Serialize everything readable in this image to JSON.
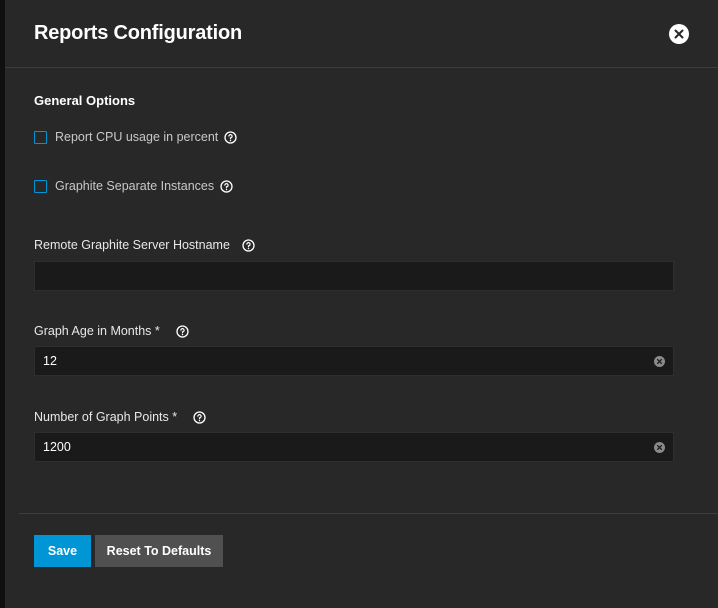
{
  "dialog": {
    "title": "Reports Configuration",
    "close_icon": "close-circle-icon"
  },
  "general_options": {
    "title": "General Options",
    "checkboxes": [
      {
        "label": "Report CPU usage in percent",
        "checked": false
      },
      {
        "label": "Graphite Separate Instances",
        "checked": false
      }
    ]
  },
  "fields": {
    "graphite_host": {
      "label": "Remote Graphite Server Hostname",
      "value": ""
    },
    "graph_age": {
      "label": "Graph Age in Months *",
      "value": "12"
    },
    "graph_points": {
      "label": "Number of Graph Points *",
      "value": "1200"
    }
  },
  "actions": {
    "save_label": "Save",
    "reset_label": "Reset To Defaults"
  },
  "colors": {
    "accent": "#0095d5",
    "dialog_bg": "#282828",
    "input_bg": "#1a1a1a",
    "secondary_button": "#505050"
  }
}
